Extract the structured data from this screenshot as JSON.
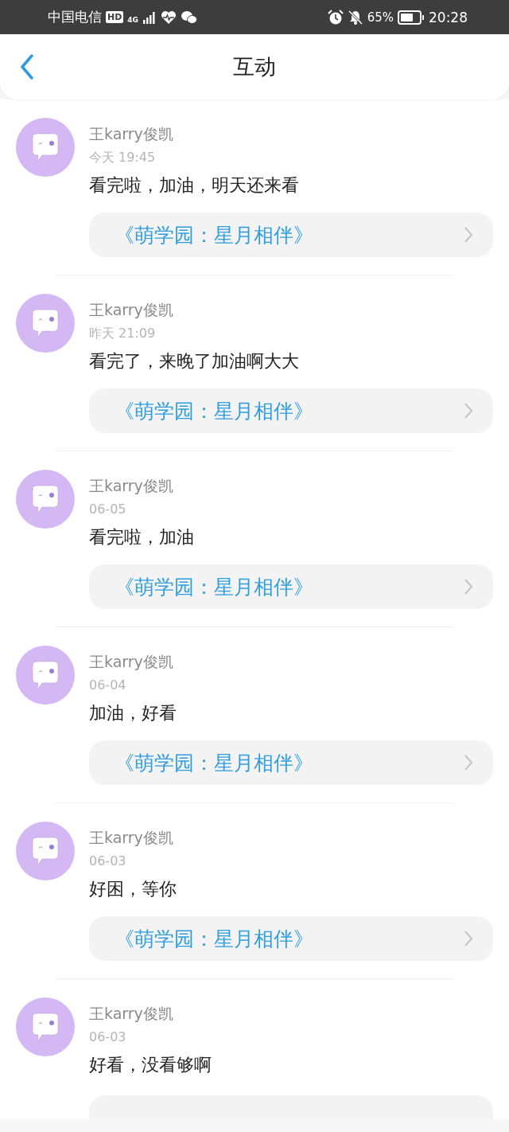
{
  "status_bar": {
    "carrier": "中国电信",
    "hd": "HD",
    "network": "4G",
    "battery": "65%",
    "time": "20:28"
  },
  "header": {
    "title": "互动"
  },
  "comments": [
    {
      "user": "王karry俊凯",
      "time": "今天 19:45",
      "text": "看完啦，加油，明天还来看",
      "link": "《萌学园：星月相伴》"
    },
    {
      "user": "王karry俊凯",
      "time": "昨天 21:09",
      "text": "看完了，来晚了加油啊大大",
      "link": "《萌学园：星月相伴》"
    },
    {
      "user": "王karry俊凯",
      "time": "06-05",
      "text": "看完啦，加油",
      "link": "《萌学园：星月相伴》"
    },
    {
      "user": "王karry俊凯",
      "time": "06-04",
      "text": "加油，好看",
      "link": "《萌学园：星月相伴》"
    },
    {
      "user": "王karry俊凯",
      "time": "06-03",
      "text": "好困，等你",
      "link": "《萌学园：星月相伴》"
    },
    {
      "user": "王karry俊凯",
      "time": "06-03",
      "text": "好看，没看够啊"
    }
  ]
}
